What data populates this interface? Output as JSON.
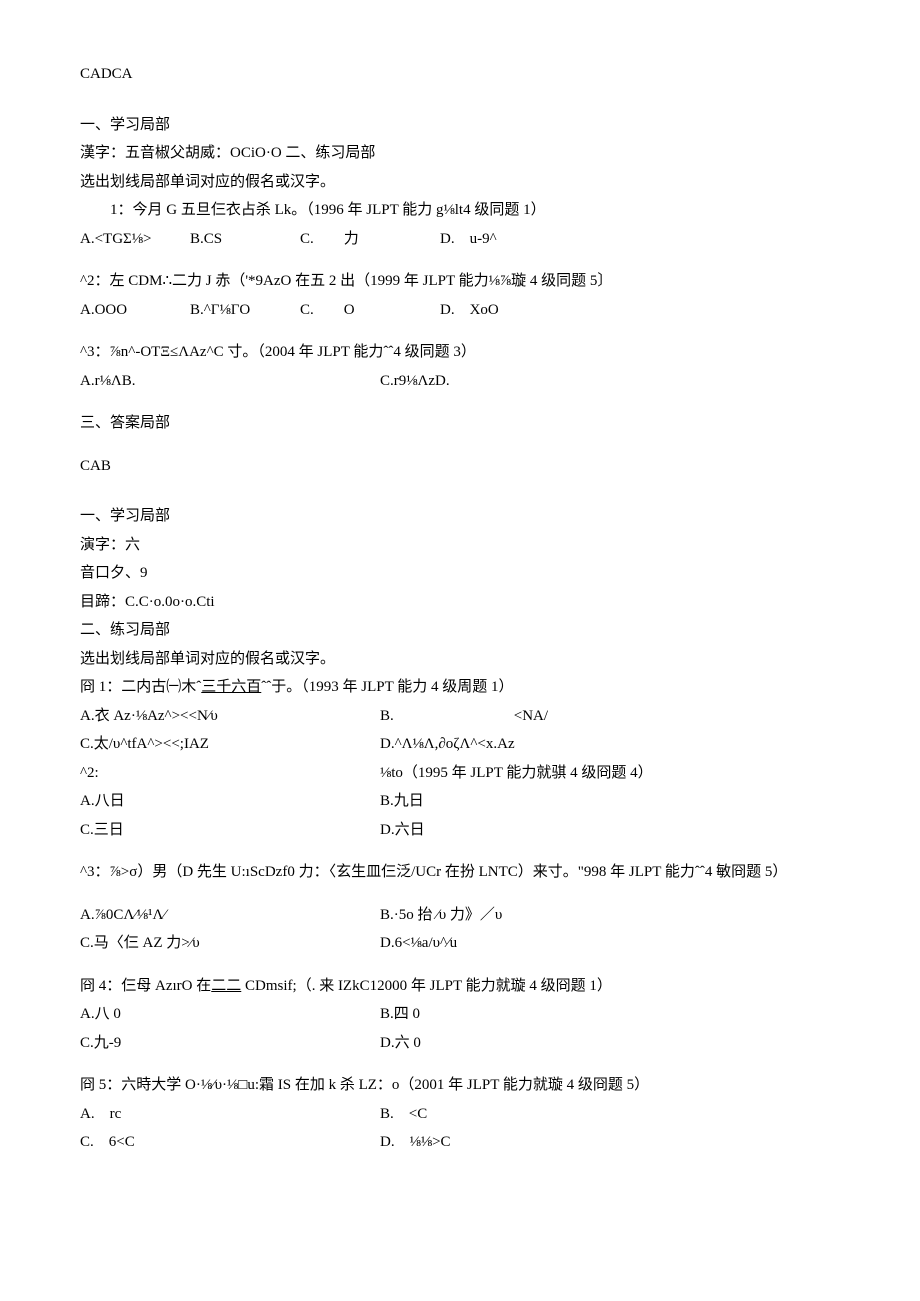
{
  "top_answer": "CADCA",
  "sec1": {
    "h1": "一、学习局部",
    "l2": "漢字：五音椒父胡威：OCiO·O 二、练习局部",
    "l3": "选出划线局部单词对应的假名或汉字。",
    "q1": {
      "stem": "1：今月 G 五旦仨衣占杀 Lk。（1996 年 JLPT 能力 g⅛lt4 级同题 1）",
      "a": "A.<TGΣ⅛>",
      "b": "B.CS",
      "c": "C.　　力",
      "d": "D.　u-9^"
    },
    "q2": {
      "stem": "^2：左 CDM∴二力 J 赤（'*9AzO 在五 2 出（1999 年 JLPT 能力⅛⅞璇 4 级同题 5〕",
      "a": "A.OOO",
      "b": "B.^Γ⅛ΓO",
      "c": "C.　　O",
      "d": "D.　XoO"
    },
    "q3": {
      "stem": "^3：⅞n^-OTΞ≤ΛAz^C 寸。（2004 年 JLPT 能力ˆˆ4 级同题 3）",
      "a": "A.r⅛ΛB.",
      "c": "C.r9⅛ΛzD."
    },
    "ans_h": "三、答案局部",
    "ans": "CAB"
  },
  "sec2": {
    "h1": "一、学习局部",
    "l2": "演字：六",
    "l3": "音口夕、9",
    "l4": "目蹄：C.C·o.0o·o.Cti",
    "h2": "二、练习局部",
    "l5": "选出划线局部单词对应的假名或汉字。",
    "q1": {
      "stem_pre": "冏 1：二内古㈠木ˆ",
      "stem_u": "三千六百",
      "stem_post": "ˆˆ于。（1993 年 JLPT 能力 4 级周题 1）",
      "a": "A.衣 Az·⅛Az^><<N⁄υ",
      "b": "B.　　　　　　　　<NA/",
      "c": "C.太/υ^tfA^><<;IAZ",
      "d": "D.^Λ⅛Λ,∂oζΛ^<x.Az"
    },
    "q2": {
      "stem_l": "^2:",
      "stem_r": "⅛to（1995 年 JLPT 能力就骐 4 级冏题 4）",
      "a": "A.八日",
      "b": "B.九日",
      "c": "C.三日",
      "d": "D.六日"
    },
    "q3": {
      "stem": "^3：⅞>σ）男（D 先生 U:ıScDzf0 力：〈玄生皿仨泛/UCr 在扮 LNTC）来寸。\"998 年 JLPT 能力ˆˆ4 敏冏题 5）",
      "a": "A.⅞0CΛ⁄⅛¹Λ⁄",
      "b": "B.·5o 抬 ⁄υ 力》／υ",
      "c": "C.马〈仨 AZ 力>⁄υ",
      "d": "D.6<⅛a/υ^⁄u"
    },
    "q4": {
      "stem_pre": "冏 4：仨母 AzırO 在",
      "stem_u": "二二",
      "stem_post": " CDmsif;（. 来 IZkC12000 年 JLPT 能力就璇 4 级冏题 1）",
      "a": "A.八 0",
      "b": "B.四 0",
      "c": "C.九-9",
      "d": "D.六 0"
    },
    "q5": {
      "stem": "冏 5：六時大学 O·⅛⁄υ·⅛□u:霜 IS 在加 k 杀 LZ：o（2001 年 JLPT 能力就璇 4 级冏题 5）",
      "a": "A.　rc",
      "b": "B.　<C",
      "c": "C.　6<C",
      "d": "D.　⅛⅛>C"
    }
  }
}
